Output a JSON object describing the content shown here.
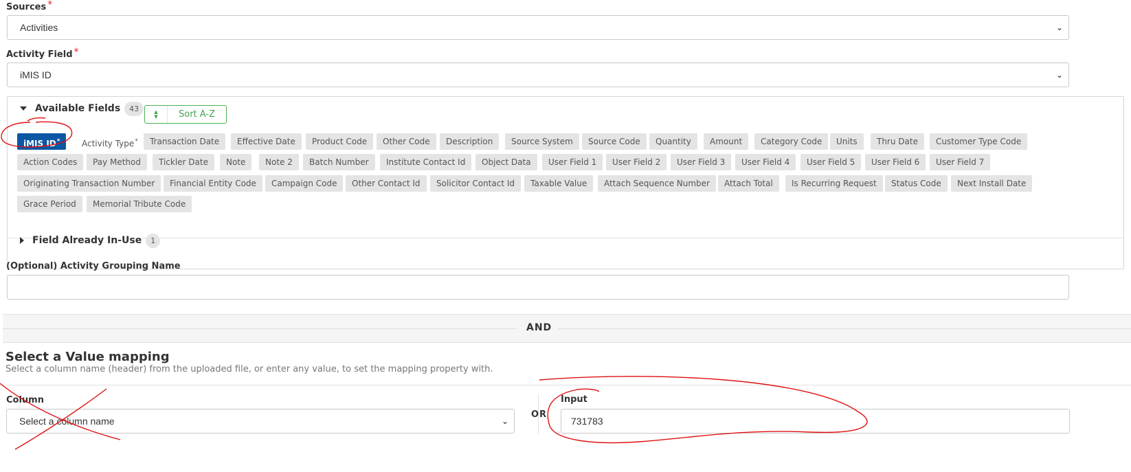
{
  "sources": {
    "label": "Sources",
    "required_mark": "*",
    "value": "Activities"
  },
  "activity_field": {
    "label": "Activity Field",
    "required_mark": "*",
    "value": "iMIS ID"
  },
  "available_fields": {
    "title": "Available Fields",
    "count": "43",
    "sort_label": "Sort A-Z",
    "chips": [
      {
        "label": "iMIS ID",
        "mark": "*",
        "state": "selected"
      },
      {
        "label": "Activity Type",
        "mark": "*",
        "state": "required"
      },
      {
        "label": "Transaction Date"
      },
      {
        "label": "Effective Date"
      },
      {
        "label": "Product Code"
      },
      {
        "label": "Other Code"
      },
      {
        "label": "Description"
      },
      {
        "label": "Source System"
      },
      {
        "label": "Source Code"
      },
      {
        "label": "Quantity"
      },
      {
        "label": "Amount"
      },
      {
        "label": "Category Code"
      },
      {
        "label": "Units"
      },
      {
        "label": "Thru Date"
      },
      {
        "label": "Customer Type Code"
      },
      {
        "label": "Action Codes"
      },
      {
        "label": "Pay Method"
      },
      {
        "label": "Tickler Date"
      },
      {
        "label": "Note"
      },
      {
        "label": "Note 2"
      },
      {
        "label": "Batch Number"
      },
      {
        "label": "Institute Contact Id"
      },
      {
        "label": "Object Data"
      },
      {
        "label": "User Field 1"
      },
      {
        "label": "User Field 2"
      },
      {
        "label": "User Field 3"
      },
      {
        "label": "User Field 4"
      },
      {
        "label": "User Field 5"
      },
      {
        "label": "User Field 6"
      },
      {
        "label": "User Field 7"
      },
      {
        "label": "Originating Transaction Number"
      },
      {
        "label": "Financial Entity Code"
      },
      {
        "label": "Campaign Code"
      },
      {
        "label": "Other Contact Id"
      },
      {
        "label": "Solicitor Contact Id"
      },
      {
        "label": "Taxable Value"
      },
      {
        "label": "Attach Sequence Number"
      },
      {
        "label": "Attach Total"
      },
      {
        "label": "Is Recurring Request"
      },
      {
        "label": "Status Code"
      },
      {
        "label": "Next Install Date"
      },
      {
        "label": "Grace Period"
      },
      {
        "label": "Memorial Tribute Code"
      }
    ]
  },
  "field_in_use": {
    "title": "Field Already In-Use",
    "count": "1"
  },
  "grouping": {
    "label": "(Optional) Activity Grouping Name",
    "value": ""
  },
  "and_label": "AND",
  "value_mapping": {
    "title": "Select a Value mapping",
    "subtitle": "Select a column name (header) from the uploaded file, or enter any value, to set the mapping property with.",
    "column_label": "Column",
    "column_placeholder": "Select a column name",
    "or_label": "OR",
    "input_label": "Input",
    "input_value": "731783"
  },
  "colors": {
    "selected_chip": "#0b57a3",
    "sort_button": "#4caf50",
    "required": "#e8202a",
    "annotation": "#e01010"
  }
}
